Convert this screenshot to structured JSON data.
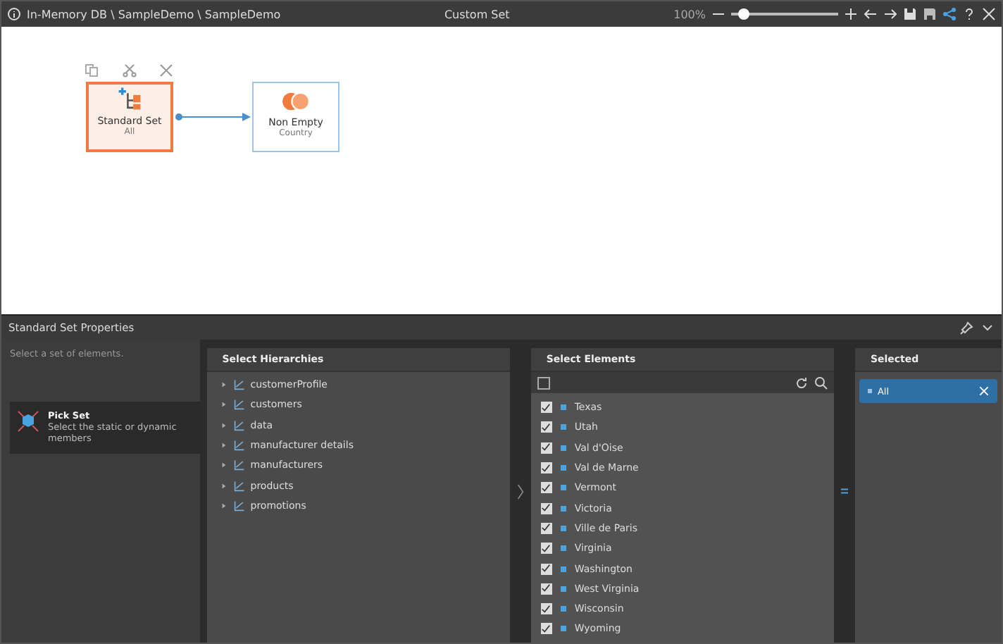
{
  "window": {
    "breadcrumb": "In-Memory DB \\ SampleDemo \\ SampleDemo",
    "title": "Custom Set",
    "zoom": {
      "reading": "100%",
      "level": 0.12
    }
  },
  "canvas": {
    "nodes": [
      {
        "kind": "set",
        "title": "Standard Set",
        "subtitle": "All",
        "selected": true
      },
      {
        "kind": "filter",
        "title": "Non Empty",
        "subtitle": "Country",
        "selected": false
      }
    ]
  },
  "properties": {
    "title": "Standard Set Properties",
    "description": "Select a set of elements.",
    "steps": [
      {
        "title": "Pick Set",
        "description": "Select the static or dynamic members",
        "selected": true
      }
    ],
    "hierarchies": {
      "title": "Select Hierarchies",
      "items": [
        "customerProfile",
        "customers",
        "data",
        "manufacturer details",
        "manufacturers",
        "products",
        "promotions"
      ]
    },
    "elements": {
      "title": "Select Elements",
      "items": [
        {
          "label": "Texas",
          "checked": true
        },
        {
          "label": "Utah",
          "checked": true
        },
        {
          "label": "Val d'Oise",
          "checked": true
        },
        {
          "label": "Val de Marne",
          "checked": true
        },
        {
          "label": "Vermont",
          "checked": true
        },
        {
          "label": "Victoria",
          "checked": true
        },
        {
          "label": "Ville de Paris",
          "checked": true
        },
        {
          "label": "Virginia",
          "checked": true
        },
        {
          "label": "Washington",
          "checked": true
        },
        {
          "label": "West Virginia",
          "checked": true
        },
        {
          "label": "Wisconsin",
          "checked": true
        },
        {
          "label": "Wyoming",
          "checked": true
        }
      ]
    },
    "selected": {
      "title": "Selected",
      "items": [
        "All"
      ]
    }
  }
}
